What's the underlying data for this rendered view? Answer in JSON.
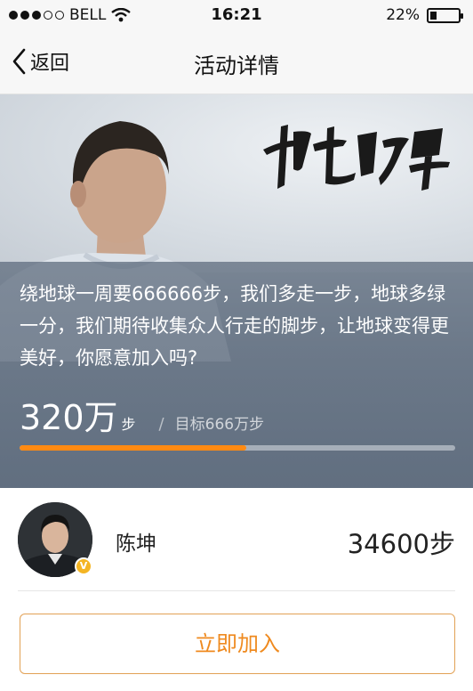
{
  "status_bar": {
    "carrier": "BELL",
    "time": "16:21",
    "battery": "22%",
    "battery_level": 0.22,
    "icons": [
      "signal-dots-icon",
      "wifi-icon",
      "battery-icon"
    ]
  },
  "nav": {
    "back_label": "返回",
    "title": "活动详情",
    "back_icon": "chevron-left-icon"
  },
  "hero": {
    "banner_text_image": "健走的力量",
    "description": "绕地球一周要666666步，我们多走一步，地球多绿一分，我们期待收集众人行走的脚步，让地球变得更美好，你愿意加入吗?",
    "steps_value": "320万",
    "steps_unit": "步",
    "separator": "/",
    "goal_text": "目标666万步",
    "progress": 0.52,
    "accent_color": "#ff8a12"
  },
  "user": {
    "name": "陈坤",
    "steps": "34600步",
    "badge": "V",
    "badge_color": "#f4b524"
  },
  "join_button": {
    "label": "立即加入",
    "color": "#ef8a1f"
  }
}
